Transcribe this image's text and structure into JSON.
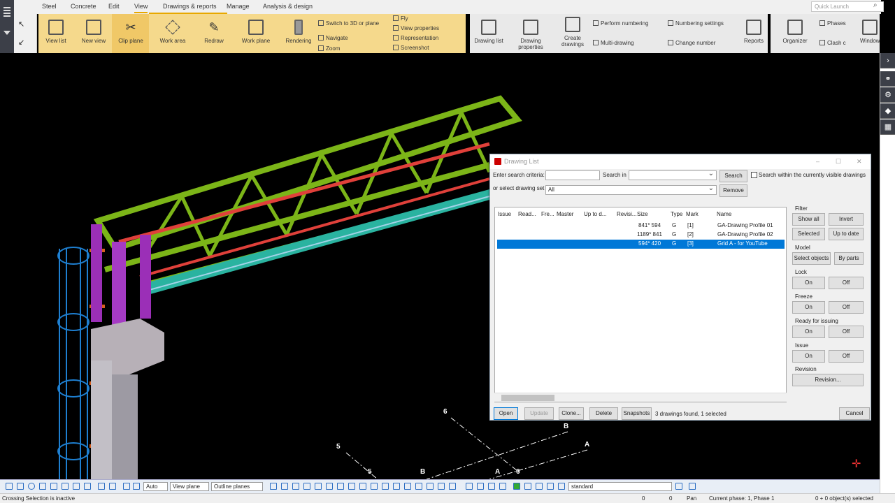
{
  "menu": {
    "tabs": [
      "Steel",
      "Concrete",
      "Edit",
      "View",
      "Drawings & reports",
      "Manage",
      "Analysis & design"
    ],
    "active": "View",
    "quick_launch_placeholder": "Quick Launch"
  },
  "ribbon": {
    "view_list": "View list",
    "new_view": "New view",
    "clip_plane": "Clip plane",
    "work_area": "Work area",
    "redraw": "Redraw",
    "work_plane": "Work plane",
    "rendering": "Rendering",
    "switch_3d": "Switch to 3D or plane",
    "navigate": "Navigate",
    "zoom": "Zoom",
    "fly": "Fly",
    "view_properties": "View properties",
    "representation": "Representation",
    "screenshot": "Screenshot",
    "drawing_list": "Drawing list",
    "drawing_properties": "Drawing properties",
    "create_drawings": "Create drawings",
    "perform_numbering": "Perform numbering",
    "multi_drawing": "Multi-drawing",
    "numbering_settings": "Numbering settings",
    "change_number": "Change number",
    "reports": "Reports",
    "organizer": "Organizer",
    "phases": "Phases",
    "clash": "Clash c",
    "window": "Window"
  },
  "grid_labels": [
    "6",
    "B",
    "A",
    "5",
    "5",
    "B",
    "A",
    "6"
  ],
  "dialog": {
    "title": "Drawing List",
    "search_label": "Enter search criteria:",
    "search_value": "",
    "search_in_label": "Search in",
    "search_in_value": "",
    "search_button": "Search",
    "search_visible_label": "Search within the currently visible drawings",
    "set_label": "or select drawing set",
    "set_value": "All",
    "remove_button": "Remove",
    "columns": [
      "Issue",
      "Read...",
      "Fre...",
      "Master",
      "Up to d...",
      "Revisi...",
      "Size",
      "Type",
      "Mark",
      "Name"
    ],
    "rows": [
      {
        "size": "841* 594",
        "type": "G",
        "mark": "[1]",
        "name": "GA-Drawing Profile 01",
        "selected": false
      },
      {
        "size": "1189* 841",
        "type": "G",
        "mark": "[2]",
        "name": "GA-Drawing Profile 02",
        "selected": false
      },
      {
        "size": "594* 420",
        "type": "G",
        "mark": "[3]",
        "name": "Grid A - for YouTube",
        "selected": true
      }
    ],
    "filter": {
      "title": "Filter",
      "show_all": "Show all",
      "invert": "Invert",
      "selected": "Selected",
      "up_to_date": "Up to date"
    },
    "model": {
      "title": "Model",
      "select_objects": "Select objects",
      "by_parts": "By parts"
    },
    "lock": {
      "title": "Lock",
      "on": "On",
      "off": "Off"
    },
    "freeze": {
      "title": "Freeze",
      "on": "On",
      "off": "Off"
    },
    "ready": {
      "title": "Ready for issuing",
      "on": "On",
      "off": "Off"
    },
    "issue": {
      "title": "Issue",
      "on": "On",
      "off": "Off"
    },
    "revision": {
      "title": "Revision",
      "button": "Revision..."
    },
    "buttons": {
      "open": "Open",
      "update": "Update",
      "clone": "Clone...",
      "delete": "Delete",
      "snapshots": "Snapshots",
      "cancel": "Cancel"
    },
    "status": "3 drawings found, 1 selected"
  },
  "bottombar": {
    "auto": "Auto",
    "view_plane": "View plane",
    "outline_planes": "Outline planes",
    "standard": "standard"
  },
  "statusbar": {
    "left": "Crossing Selection is inactive",
    "x": "0",
    "y": "0",
    "pan": "Pan",
    "phase": "Current phase: 1, Phase 1",
    "objects": "0 + 0 object(s) selected"
  },
  "colors": {
    "ribbon_view": "#f5d98c",
    "selection": "#0078d7",
    "truss": "#7cb518",
    "column": "#9b2fb7",
    "beam_red": "#e0403a",
    "cage": "#1e7fd0"
  }
}
